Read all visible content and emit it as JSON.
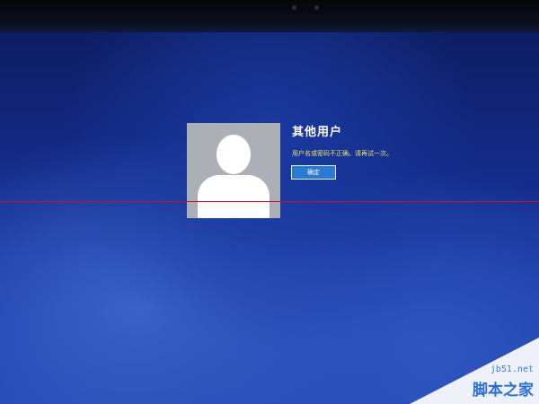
{
  "login": {
    "username": "其他用户",
    "error_message": "用户名或密码不正确。请再试一次。",
    "ok_button_label": "确定"
  },
  "icons": {
    "avatar": "user-silhouette-icon",
    "camera": "camera-lens-icon"
  },
  "colors": {
    "screen_background": "#1b3aa6",
    "error_text": "#e9e36a",
    "button": "#2a79d3",
    "avatar_tile": "#aab0b5",
    "guide_line": "#c8102e"
  },
  "watermark": {
    "site": "jb51.net",
    "name": "脚本之家"
  }
}
